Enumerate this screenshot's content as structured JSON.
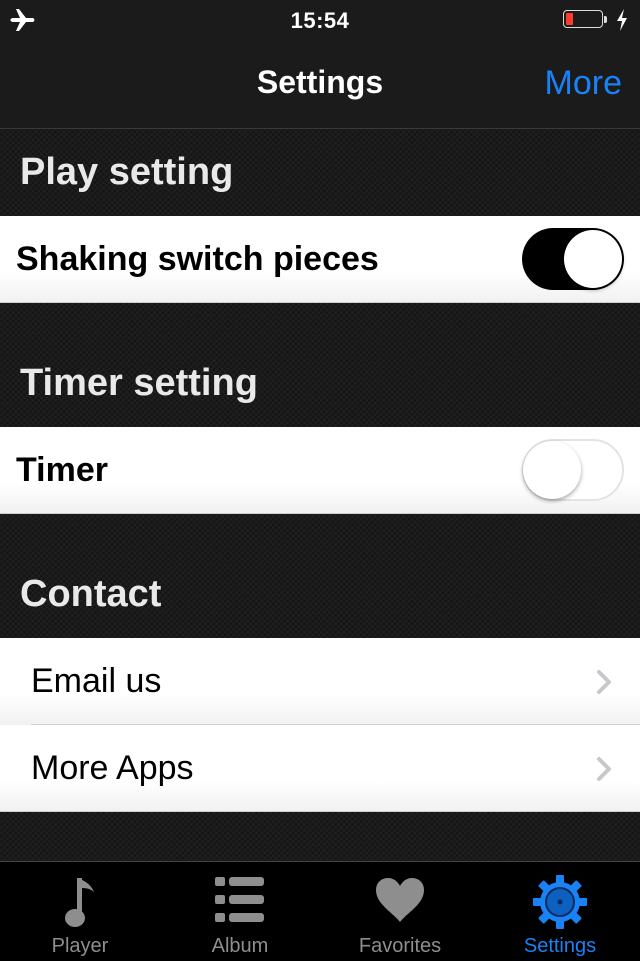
{
  "status_bar": {
    "time": "15:54",
    "left_icon": "airplane-mode-icon",
    "battery_icon": "battery-low-icon",
    "charging_icon": "charging-bolt-icon"
  },
  "nav_bar": {
    "title": "Settings",
    "right_button": "More"
  },
  "sections": [
    {
      "header": "Play setting",
      "rows": [
        {
          "label": "Shaking switch pieces",
          "control": "toggle",
          "value": true
        }
      ]
    },
    {
      "header": "Timer setting",
      "rows": [
        {
          "label": "Timer",
          "control": "toggle",
          "value": false
        }
      ]
    },
    {
      "header": "Contact",
      "rows": [
        {
          "label": "Email us",
          "control": "chevron"
        },
        {
          "label": "More Apps",
          "control": "chevron"
        }
      ]
    }
  ],
  "tab_bar": {
    "items": [
      {
        "label": "Player",
        "icon": "music-note-icon",
        "active": false
      },
      {
        "label": "Album",
        "icon": "list-icon",
        "active": false
      },
      {
        "label": "Favorites",
        "icon": "heart-icon",
        "active": false
      },
      {
        "label": "Settings",
        "icon": "gear-icon",
        "active": true
      }
    ]
  },
  "colors": {
    "accent": "#1a82f7",
    "battery_low": "#ff3b30",
    "inactive_tab": "#8e8e8e"
  }
}
